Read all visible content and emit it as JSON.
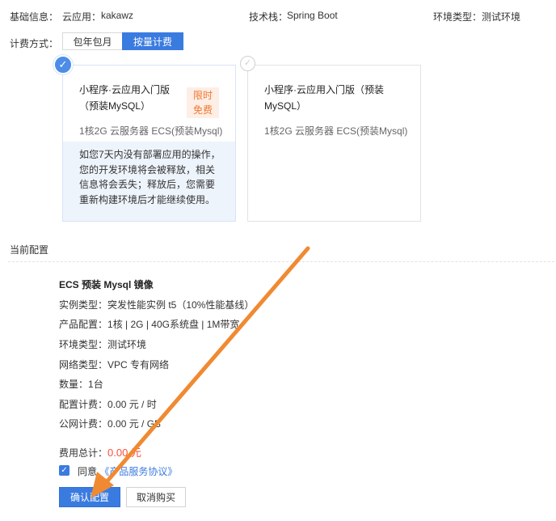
{
  "basic_info": {
    "label": "基础信息：",
    "app_label": "云应用：",
    "app_value": "kakawz",
    "stack_label": "技术栈：",
    "stack_value": "Spring Boot",
    "env_label": "环境类型：",
    "env_value": "测试环境"
  },
  "billing": {
    "label": "计费方式：",
    "options": [
      "包年包月",
      "按量计费"
    ],
    "selected": "按量计费"
  },
  "plans": [
    {
      "title": "小程序·云应用入门版（预装MySQL）",
      "badge": "限时免费",
      "spec": "1核2G 云服务器 ECS(预装Mysql)",
      "note": "如您7天内没有部署应用的操作，您的开发环境将会被释放，相关信息将会丢失；释放后，您需要重新构建环境后才能继续使用。",
      "selected": true
    },
    {
      "title": "小程序·云应用入门版（预装MySQL）",
      "spec": "1核2G 云服务器 ECS(预装Mysql)",
      "selected": false
    }
  ],
  "current_config": {
    "heading": "当前配置",
    "image_name": "ECS 预装 Mysql 镜像",
    "rows": [
      {
        "label": "实例类型：",
        "value": "突发性能实例 t5（10%性能基线）"
      },
      {
        "label": "产品配置：",
        "value": "1核 | 2G | 40G系统盘 | 1M带宽"
      },
      {
        "label": "环境类型：",
        "value": "测试环境"
      },
      {
        "label": "网络类型：",
        "value": "VPC 专有网络"
      },
      {
        "label": "数量：",
        "value": "1台"
      },
      {
        "label": "配置计费：",
        "value": "0.00 元 / 时"
      },
      {
        "label": "公网计费：",
        "value": "0.00 元 / GB"
      }
    ],
    "total_label": "费用总计：",
    "total_value": "0.00 元"
  },
  "agreement": {
    "prefix": "同意",
    "link": "《产品服务协议》",
    "checked": true
  },
  "actions": {
    "confirm": "确认配置",
    "cancel": "取消购买"
  },
  "colors": {
    "accent": "#3a7be0",
    "badge_text": "#f0782d",
    "total_value": "#ff4d3a",
    "annotation_arrow": "#f08a32"
  }
}
